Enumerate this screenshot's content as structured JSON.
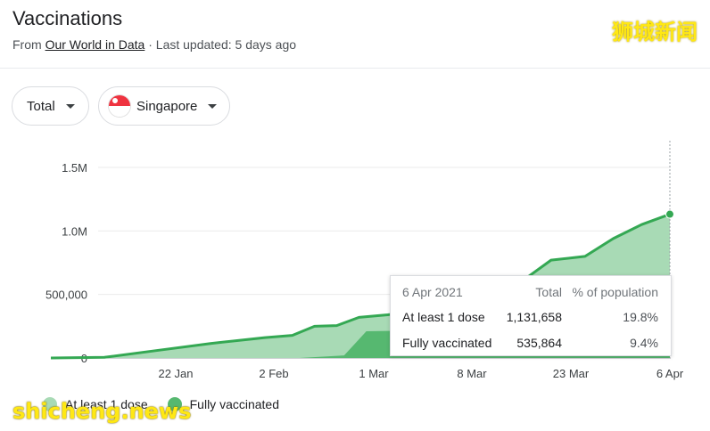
{
  "header": {
    "title": "Vaccinations",
    "from_label": "From",
    "source_link": "Our World in Data",
    "updated": " · Last updated: 5 days ago",
    "watermark_top": "狮城新闻"
  },
  "filters": {
    "metric": "Total",
    "country": "Singapore",
    "flag_icon": "singapore-flag-icon"
  },
  "tooltip": {
    "date": "6 Apr 2021",
    "col_total": "Total",
    "col_pct": "% of population",
    "rows": [
      {
        "label": "At least 1 dose",
        "total": "1,131,658",
        "pct": "19.8%"
      },
      {
        "label": "Fully vaccinated",
        "total": "535,864",
        "pct": "9.4%"
      }
    ]
  },
  "legend": [
    {
      "name": "At least 1 dose",
      "color": "#a8dab5"
    },
    {
      "name": "Fully vaccinated",
      "color": "#56b870"
    }
  ],
  "watermark_bottom": "shicheng.news",
  "chart_data": {
    "type": "area",
    "x_ticks": [
      "22 Jan",
      "2 Feb",
      "1 Mar",
      "8 Mar",
      "23 Mar",
      "6 Apr"
    ],
    "y_ticks": [
      "0",
      "500,000",
      "1.0M",
      "1.5M"
    ],
    "ylim": [
      0,
      1500000
    ],
    "grid": true,
    "series": [
      {
        "name": "At least 1 dose",
        "color": "#a8dab5",
        "points": [
          [
            "2021-01-08",
            0
          ],
          [
            "2021-01-14",
            5000
          ],
          [
            "2021-01-20",
            60000
          ],
          [
            "2021-01-26",
            115000
          ],
          [
            "2021-02-01",
            160000
          ],
          [
            "2021-02-07",
            178000
          ],
          [
            "2021-02-13",
            250000
          ],
          [
            "2021-02-19",
            255000
          ],
          [
            "2021-02-25",
            320000
          ],
          [
            "2021-03-02",
            340000
          ],
          [
            "2021-03-09",
            420000
          ],
          [
            "2021-03-16",
            620000
          ],
          [
            "2021-03-20",
            770000
          ],
          [
            "2021-03-25",
            800000
          ],
          [
            "2021-03-29",
            940000
          ],
          [
            "2021-04-02",
            1050000
          ],
          [
            "2021-04-06",
            1131658
          ]
        ]
      },
      {
        "name": "Fully vaccinated",
        "color": "#56b870",
        "points": [
          [
            "2021-01-08",
            0
          ],
          [
            "2021-02-09",
            0
          ],
          [
            "2021-02-21",
            20000
          ],
          [
            "2021-02-27",
            210000
          ],
          [
            "2021-03-03",
            215000
          ],
          [
            "2021-03-15",
            330000
          ],
          [
            "2021-03-25",
            420000
          ],
          [
            "2021-04-06",
            535864
          ]
        ]
      }
    ]
  }
}
